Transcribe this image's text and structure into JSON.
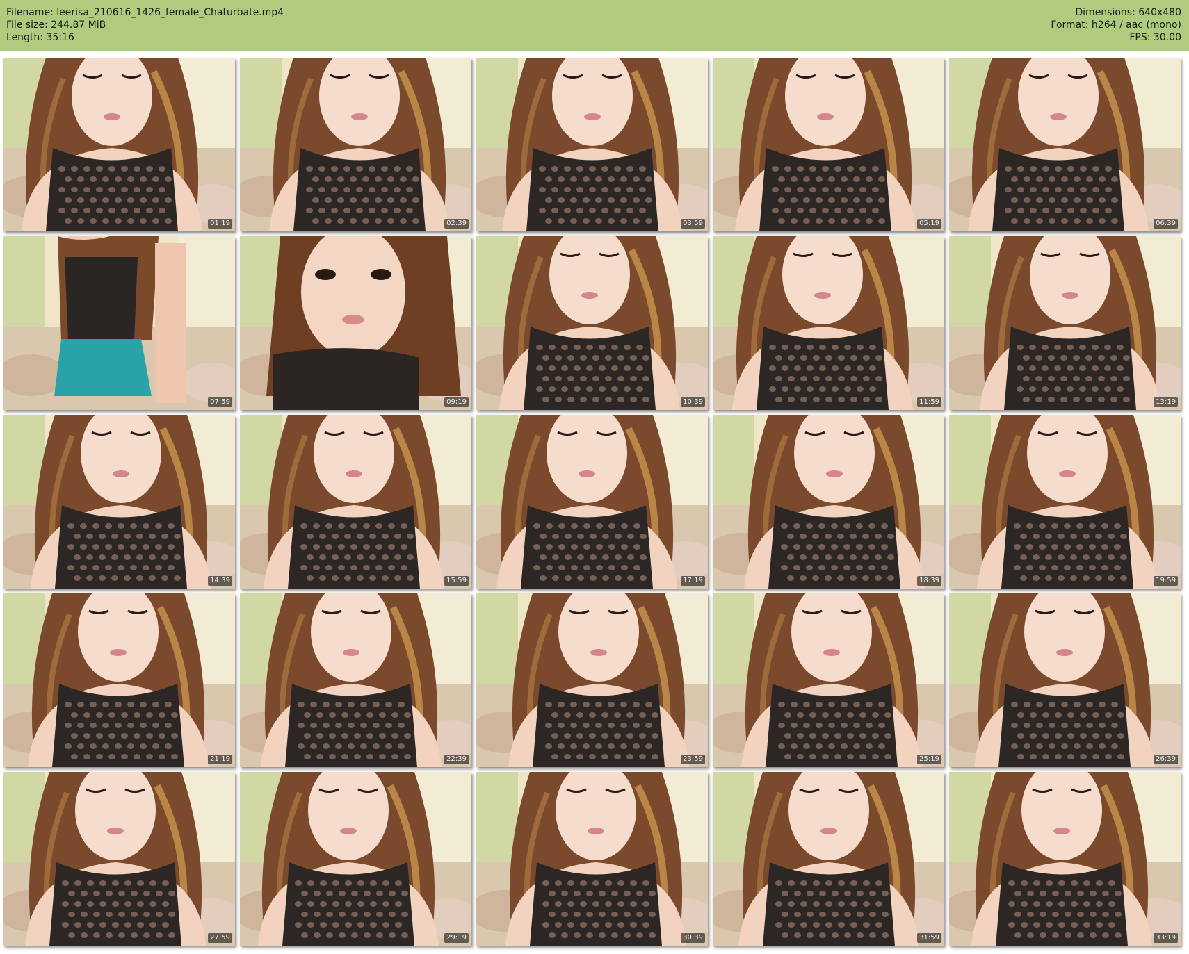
{
  "header": {
    "filename_line": "Filename: leerisa_210616_1426_female_Chaturbate.mp4",
    "filesize_line": "File size: 244.87 MiB",
    "length_line": "Length: 35:16",
    "dimensions_line": "Dimensions: 640x480",
    "format_line": "Format: h264 / aac (mono)",
    "fps_line": "FPS: 30.00"
  },
  "colors": {
    "header_bg": "#aecb7e",
    "timestamp_bg": "#000000"
  },
  "thumbnails": [
    {
      "timestamp": "01:19",
      "scene": "portrait"
    },
    {
      "timestamp": "02:39",
      "scene": "portrait"
    },
    {
      "timestamp": "03:59",
      "scene": "portrait"
    },
    {
      "timestamp": "05:19",
      "scene": "portrait"
    },
    {
      "timestamp": "06:39",
      "scene": "portrait"
    },
    {
      "timestamp": "07:59",
      "scene": "standing"
    },
    {
      "timestamp": "09:19",
      "scene": "closeup"
    },
    {
      "timestamp": "10:39",
      "scene": "portrait"
    },
    {
      "timestamp": "11:59",
      "scene": "portrait"
    },
    {
      "timestamp": "13:19",
      "scene": "portrait"
    },
    {
      "timestamp": "14:39",
      "scene": "portrait"
    },
    {
      "timestamp": "15:59",
      "scene": "portrait"
    },
    {
      "timestamp": "17:19",
      "scene": "portrait"
    },
    {
      "timestamp": "18:39",
      "scene": "portrait"
    },
    {
      "timestamp": "19:59",
      "scene": "portrait"
    },
    {
      "timestamp": "21:19",
      "scene": "portrait"
    },
    {
      "timestamp": "22:39",
      "scene": "portrait"
    },
    {
      "timestamp": "23:59",
      "scene": "portrait"
    },
    {
      "timestamp": "25:19",
      "scene": "portrait"
    },
    {
      "timestamp": "26:39",
      "scene": "portrait"
    },
    {
      "timestamp": "27:59",
      "scene": "portrait"
    },
    {
      "timestamp": "29:19",
      "scene": "portrait"
    },
    {
      "timestamp": "30:39",
      "scene": "portrait"
    },
    {
      "timestamp": "31:59",
      "scene": "portrait"
    },
    {
      "timestamp": "33:19",
      "scene": "portrait"
    }
  ]
}
